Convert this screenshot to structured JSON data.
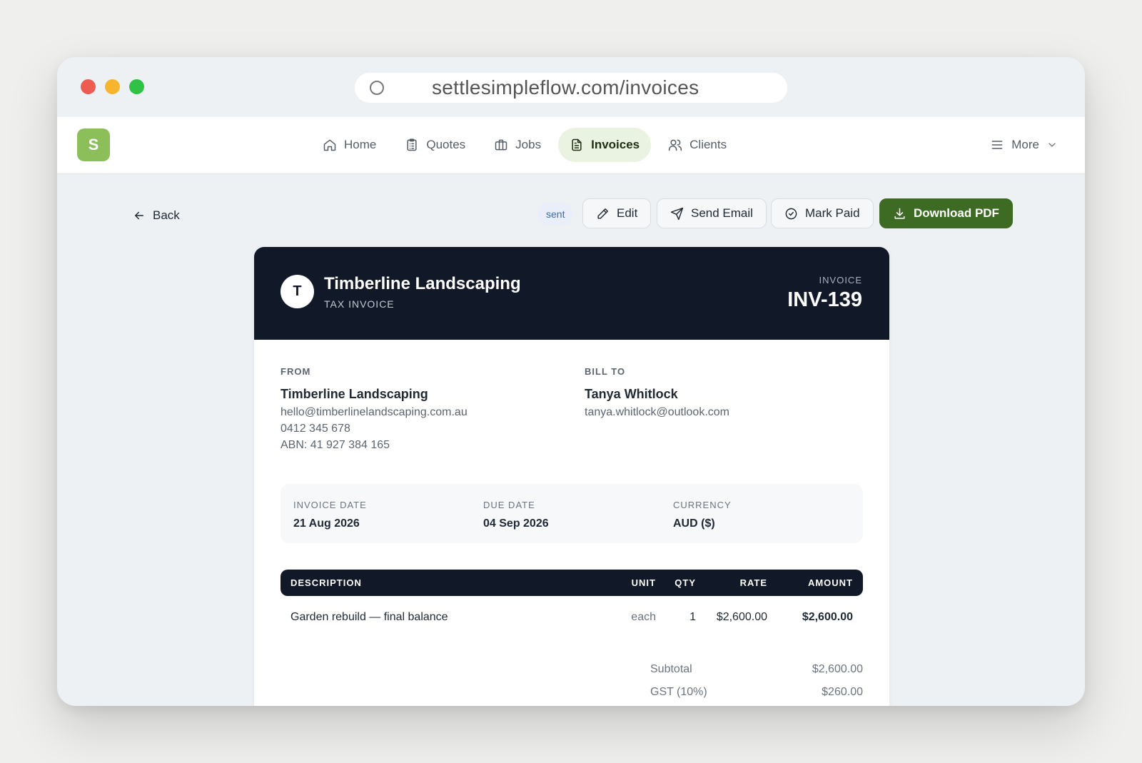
{
  "browser": {
    "url": "settlesimpleflow.com/invoices"
  },
  "app": {
    "logo_letter": "S"
  },
  "nav": {
    "items": [
      {
        "label": "Home",
        "icon": "home-icon"
      },
      {
        "label": "Quotes",
        "icon": "clipboard-icon"
      },
      {
        "label": "Jobs",
        "icon": "briefcase-icon"
      },
      {
        "label": "Invoices",
        "icon": "file-icon",
        "active": true
      },
      {
        "label": "Clients",
        "icon": "users-icon"
      }
    ],
    "more_label": "More"
  },
  "toolbar": {
    "back_label": "Back",
    "status": "sent",
    "edit_label": "Edit",
    "send_email_label": "Send Email",
    "mark_paid_label": "Mark Paid",
    "download_pdf_label": "Download PDF"
  },
  "invoice": {
    "company_initial": "T",
    "company_name": "Timberline Landscaping",
    "doc_type": "TAX INVOICE",
    "number_label": "INVOICE",
    "number": "INV-139",
    "from": {
      "label": "FROM",
      "name": "Timberline Landscaping",
      "email": "hello@timberlinelandscaping.com.au",
      "phone": "0412 345 678",
      "abn": "ABN: 41 927 384 165"
    },
    "bill_to": {
      "label": "BILL TO",
      "name": "Tanya Whitlock",
      "email": "tanya.whitlock@outlook.com"
    },
    "meta": {
      "invoice_date_label": "INVOICE DATE",
      "invoice_date": "21 Aug 2026",
      "due_date_label": "DUE DATE",
      "due_date": "04 Sep 2026",
      "currency_label": "CURRENCY",
      "currency": "AUD ($)"
    },
    "table": {
      "headers": {
        "description": "DESCRIPTION",
        "unit": "UNIT",
        "qty": "QTY",
        "rate": "RATE",
        "amount": "AMOUNT"
      },
      "rows": [
        {
          "description": "Garden rebuild — final balance",
          "unit": "each",
          "qty": "1",
          "rate": "$2,600.00",
          "amount": "$2,600.00"
        }
      ]
    },
    "totals": {
      "subtotal_label": "Subtotal",
      "subtotal": "$2,600.00",
      "gst_label": "GST (10%)",
      "gst": "$260.00"
    }
  },
  "colors": {
    "brand_green": "#3d6b23",
    "logo_green": "#8cbf5a",
    "header_navy": "#111827",
    "status_blue": "#3c6bb0"
  }
}
